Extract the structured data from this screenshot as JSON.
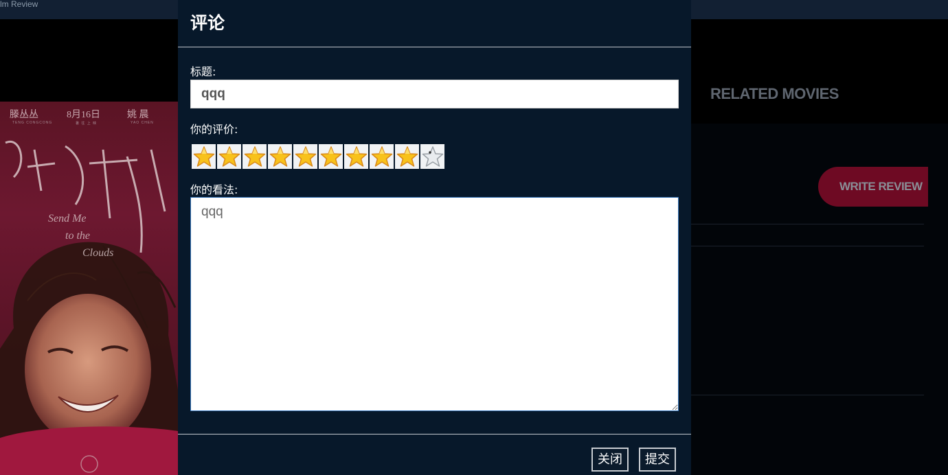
{
  "window": {
    "title": "lm Review"
  },
  "background": {
    "related_title": "RELATED MOVIES",
    "write_review_label": "WRITE REVIEW",
    "poster": {
      "cast": [
        "滕丛丛",
        "8月16日",
        "姚 晨"
      ],
      "subtitle_lines": [
        "TENG CONGCONG",
        "暑 往 上 映",
        "YAO CHEN"
      ],
      "calligraphy": "送我上青云",
      "english_title": "Send Me to the Clouds"
    }
  },
  "modal": {
    "title": "评论",
    "title_label": "标题:",
    "title_value": "qqq",
    "rating_label": "你的评价:",
    "rating": {
      "value": 9,
      "max": 10
    },
    "opinion_label": "你的看法:",
    "opinion_value": "qqq",
    "close_label": "关闭",
    "submit_label": "提交"
  },
  "colors": {
    "modal_bg": "#07182a",
    "accent_red": "#6e0a23",
    "star_gold": "#f8c21b"
  }
}
